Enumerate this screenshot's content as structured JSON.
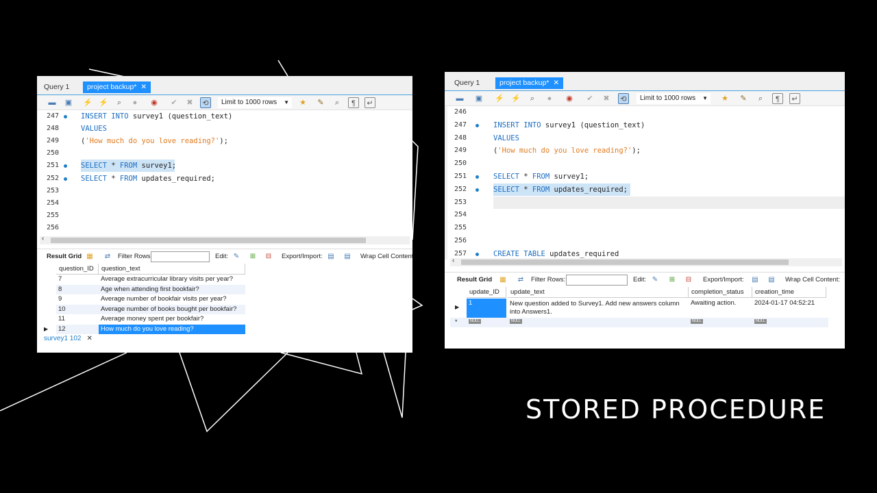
{
  "slide_title": "STORED PROCEDURE",
  "left": {
    "tabs": [
      {
        "label": "Query 1"
      },
      {
        "label": "project backup*",
        "active": true,
        "close": "✕"
      }
    ],
    "toolbar": {
      "limit_label": "Limit to 1000 rows"
    },
    "editor_lines": [
      {
        "num": "247",
        "dot": true,
        "tokens": [
          [
            "kw",
            "INSERT INTO"
          ],
          [
            "plain",
            " survey1 (question_text)"
          ]
        ]
      },
      {
        "num": "248",
        "dot": false,
        "tokens": [
          [
            "kw",
            "VALUES"
          ]
        ]
      },
      {
        "num": "249",
        "dot": false,
        "tokens": [
          [
            "plain",
            "("
          ],
          [
            "str",
            "'How much do you love reading?'"
          ],
          [
            "plain",
            ");"
          ]
        ]
      },
      {
        "num": "250",
        "dot": false,
        "tokens": []
      },
      {
        "num": "251",
        "dot": true,
        "highlight": true,
        "tokens": [
          [
            "kw",
            "SELECT"
          ],
          [
            "plain",
            " * "
          ],
          [
            "kw",
            "FROM"
          ],
          [
            "plain",
            " survey1;"
          ]
        ]
      },
      {
        "num": "252",
        "dot": true,
        "tokens": [
          [
            "kw",
            "SELECT"
          ],
          [
            "plain",
            " * "
          ],
          [
            "kw",
            "FROM"
          ],
          [
            "plain",
            " updates_required;"
          ]
        ]
      },
      {
        "num": "253",
        "dot": false,
        "tokens": []
      },
      {
        "num": "254",
        "dot": false,
        "tokens": []
      },
      {
        "num": "255",
        "dot": false,
        "tokens": []
      },
      {
        "num": "256",
        "dot": false,
        "tokens": []
      }
    ],
    "resultbar": {
      "result_grid": "Result Grid",
      "filter_rows": "Filter Rows:",
      "edit": "Edit:",
      "export": "Export/Import:",
      "wrap": "Wrap Cell Content:"
    },
    "grid": {
      "columns": [
        "question_ID",
        "question_text"
      ],
      "rows": [
        [
          "7",
          "Average extracurricular library visits per year?"
        ],
        [
          "8",
          "Age when attending first bookfair?"
        ],
        [
          "9",
          "Average number of bookfair visits per year?"
        ],
        [
          "10",
          "Average number of books bought per bookfair?"
        ],
        [
          "11",
          "Average money spent per bookfair?"
        ],
        [
          "12",
          "How much do you love reading?"
        ]
      ]
    },
    "bottom_tab": {
      "label": "survey1 102",
      "close": "✕"
    }
  },
  "right": {
    "tabs": [
      {
        "label": "Query 1"
      },
      {
        "label": "project backup*",
        "active": true,
        "close": "✕"
      }
    ],
    "toolbar": {
      "limit_label": "Limit to 1000 rows"
    },
    "editor_lines": [
      {
        "num": "246",
        "dot": false,
        "tokens": []
      },
      {
        "num": "247",
        "dot": true,
        "tokens": [
          [
            "kw",
            "INSERT INTO"
          ],
          [
            "plain",
            " survey1 (question_text)"
          ]
        ]
      },
      {
        "num": "248",
        "dot": false,
        "tokens": [
          [
            "kw",
            "VALUES"
          ]
        ]
      },
      {
        "num": "249",
        "dot": false,
        "tokens": [
          [
            "plain",
            "("
          ],
          [
            "str",
            "'How much do you love reading?'"
          ],
          [
            "plain",
            ");"
          ]
        ]
      },
      {
        "num": "250",
        "dot": false,
        "tokens": []
      },
      {
        "num": "251",
        "dot": true,
        "tokens": [
          [
            "kw",
            "SELECT"
          ],
          [
            "plain",
            " * "
          ],
          [
            "kw",
            "FROM"
          ],
          [
            "plain",
            " survey1;"
          ]
        ]
      },
      {
        "num": "252",
        "dot": true,
        "highlight": true,
        "tokens": [
          [
            "kw",
            "SELECT"
          ],
          [
            "plain",
            " * "
          ],
          [
            "kw",
            "FROM"
          ],
          [
            "plain",
            " updates_required;"
          ]
        ]
      },
      {
        "num": "253",
        "dot": false,
        "tokens": []
      },
      {
        "num": "254",
        "dot": false,
        "tokens": []
      },
      {
        "num": "255",
        "dot": false,
        "tokens": []
      },
      {
        "num": "256",
        "dot": false,
        "tokens": []
      },
      {
        "num": "257",
        "dot": true,
        "tokens": [
          [
            "kw",
            "CREATE TABLE"
          ],
          [
            "plain",
            " updates_required"
          ]
        ]
      }
    ],
    "resultbar": {
      "result_grid": "Result Grid",
      "filter_rows": "Filter Rows:",
      "edit": "Edit:",
      "export": "Export/Import:",
      "wrap": "Wrap Cell Content:"
    },
    "grid": {
      "columns": [
        "update_ID",
        "update_text",
        "completion_status",
        "creation_time"
      ],
      "row": {
        "update_ID": "1",
        "update_text_1": "New question added to Survey1. Add new answers column",
        "update_text_2": "into Answers1.",
        "completion_status": "Awaiting action.",
        "creation_time": "2024-01-17 04:52:21"
      },
      "null_label": "NULL"
    }
  }
}
